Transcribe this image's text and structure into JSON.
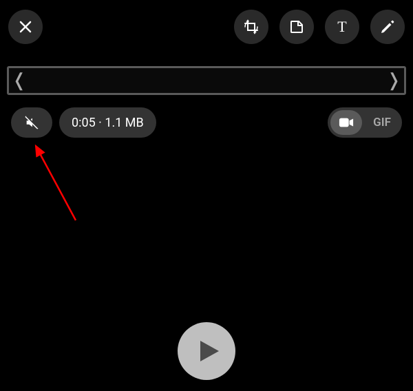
{
  "top": {
    "close": "close",
    "crop": "crop-rotate",
    "sticker": "sticker",
    "text_label": "T",
    "draw": "draw"
  },
  "trim": {
    "left_handle": "❬",
    "right_handle": "❭"
  },
  "info": {
    "duration_size": "0:05 · 1.1 MB"
  },
  "toggle": {
    "video": "video",
    "gif_label": "GIF"
  },
  "play": "play"
}
